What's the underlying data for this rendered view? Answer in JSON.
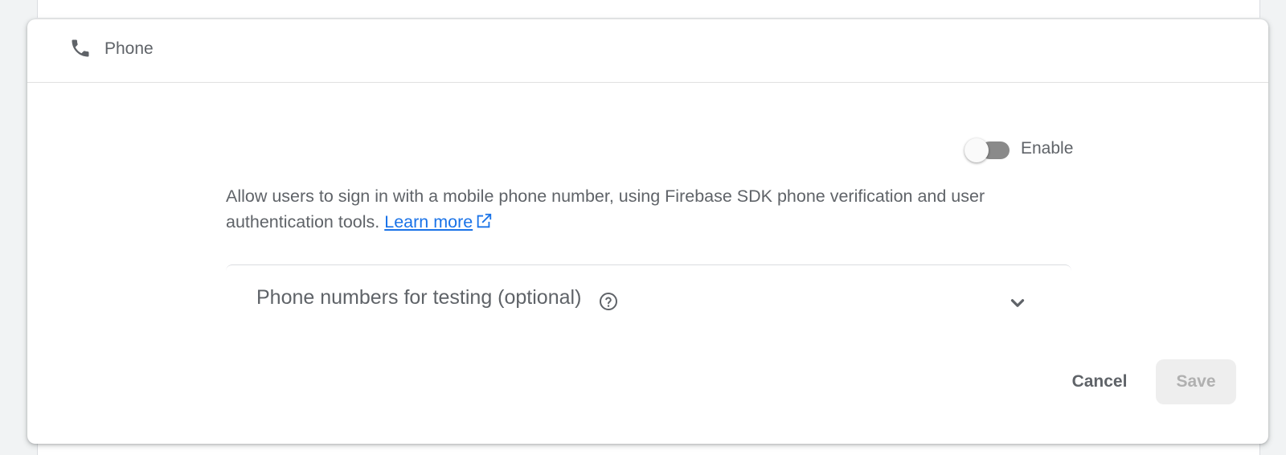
{
  "provider": {
    "name": "Phone",
    "icon": "phone-icon"
  },
  "toggle": {
    "label": "Enable",
    "enabled": false
  },
  "description": {
    "text": "Allow users to sign in with a mobile phone number, using Firebase SDK phone verification and user authentication tools.",
    "link_label": "Learn more",
    "link_icon": "external-link-icon"
  },
  "testing_section": {
    "title": "Phone numbers for testing (optional)",
    "help_icon": "help-icon",
    "expand_icon": "chevron-down-icon"
  },
  "actions": {
    "cancel_label": "Cancel",
    "save_label": "Save"
  },
  "colors": {
    "accent": "#1a73e8",
    "text": "#5f6368",
    "toggle_off": "#8a8a8a",
    "disabled_bg": "#eeeeee"
  }
}
